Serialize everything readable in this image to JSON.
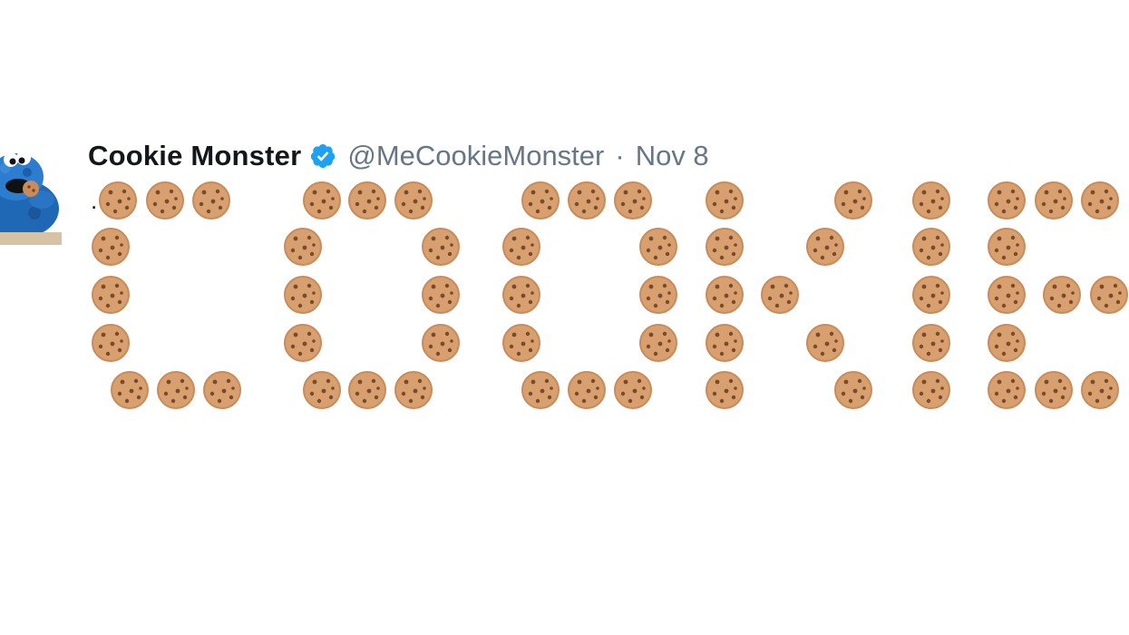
{
  "tweet": {
    "display_name": "Cookie Monster",
    "verified": true,
    "handle": "@MeCookieMonster",
    "separator": "·",
    "date": "Nov 8",
    "text_prefix": "."
  },
  "cookie_art": {
    "emoji": "cookie",
    "rows": [
      ".🍪🍪🍪 🍪🍪🍪 🍪🍪🍪 🍪 🍪 🍪 🍪🍪🍪",
      "🍪 🍪 🍪 🍪 🍪 🍪 🍪 🍪 🍪",
      "🍪 🍪 🍪 🍪 🍪 🍪🍪 🍪 🍪🍪🍪",
      "🍪 🍪 🍪 🍪 🍪 🍪 🍪 🍪 🍪",
      "🍪🍪🍪 🍪🍪🍪 🍪🍪🍪 🍪 🍪 🍪 🍪🍪🍪"
    ]
  },
  "colors": {
    "name": "#14171a",
    "handle": "#657786",
    "verified": "#1da1f2",
    "cookie": "#d7a06e",
    "cookie_edge": "#c98b5a",
    "chip": "#7a4a2c"
  },
  "icons": {
    "verified": "verified-badge-icon",
    "avatar": "cookie-monster-avatar"
  }
}
